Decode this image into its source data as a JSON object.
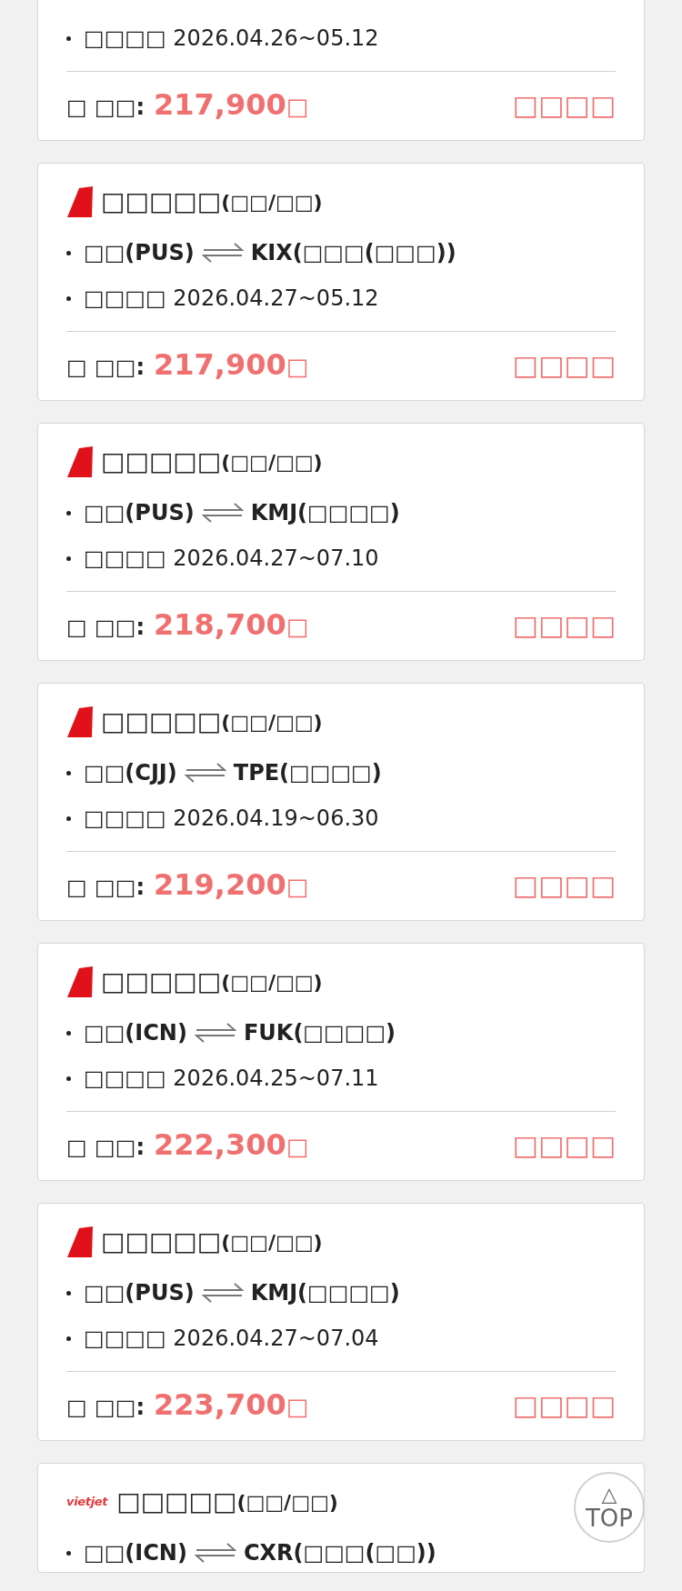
{
  "fares": [
    {
      "period": {
        "label": "□□□□",
        "dates": "2026.04.26~05.12"
      },
      "price": {
        "label": "□ □□:",
        "amount": "217,900",
        "unit": "□"
      },
      "book": "□□□□"
    },
    {
      "airline": {
        "logo": {
          "kind": "tail"
        },
        "name": "□□□□□",
        "type": "(□□/□□)"
      },
      "route": {
        "origin": "□□(PUS)",
        "destination": "KIX(□□□(□□□))"
      },
      "period": {
        "label": "□□□□",
        "dates": "2026.04.27~05.12"
      },
      "price": {
        "label": "□ □□:",
        "amount": "217,900",
        "unit": "□"
      },
      "book": "□□□□"
    },
    {
      "airline": {
        "logo": {
          "kind": "tail"
        },
        "name": "□□□□□",
        "type": "(□□/□□)"
      },
      "route": {
        "origin": "□□(PUS)",
        "destination": "KMJ(□□□□)"
      },
      "period": {
        "label": "□□□□",
        "dates": "2026.04.27~07.10"
      },
      "price": {
        "label": "□ □□:",
        "amount": "218,700",
        "unit": "□"
      },
      "book": "□□□□"
    },
    {
      "airline": {
        "logo": {
          "kind": "tail"
        },
        "name": "□□□□□",
        "type": "(□□/□□)"
      },
      "route": {
        "origin": "□□(CJJ)",
        "destination": "TPE(□□□□)"
      },
      "period": {
        "label": "□□□□",
        "dates": "2026.04.19~06.30"
      },
      "price": {
        "label": "□ □□:",
        "amount": "219,200",
        "unit": "□"
      },
      "book": "□□□□"
    },
    {
      "airline": {
        "logo": {
          "kind": "tail"
        },
        "name": "□□□□□",
        "type": "(□□/□□)"
      },
      "route": {
        "origin": "□□(ICN)",
        "destination": "FUK(□□□□)"
      },
      "period": {
        "label": "□□□□",
        "dates": "2026.04.25~07.11"
      },
      "price": {
        "label": "□ □□:",
        "amount": "222,300",
        "unit": "□"
      },
      "book": "□□□□"
    },
    {
      "airline": {
        "logo": {
          "kind": "tail"
        },
        "name": "□□□□□",
        "type": "(□□/□□)"
      },
      "route": {
        "origin": "□□(PUS)",
        "destination": "KMJ(□□□□)"
      },
      "period": {
        "label": "□□□□",
        "dates": "2026.04.27~07.04"
      },
      "price": {
        "label": "□ □□:",
        "amount": "223,700",
        "unit": "□"
      },
      "book": "□□□□"
    },
    {
      "airline": {
        "logo": {
          "kind": "wordmark",
          "text": "vietjet"
        },
        "name": "□□□□□",
        "type": "(□□/□□)"
      },
      "route": {
        "origin": "□□(ICN)",
        "destination": "CXR(□□□(□□))"
      }
    }
  ],
  "top_button": {
    "arrow": "△",
    "label": "TOP"
  }
}
